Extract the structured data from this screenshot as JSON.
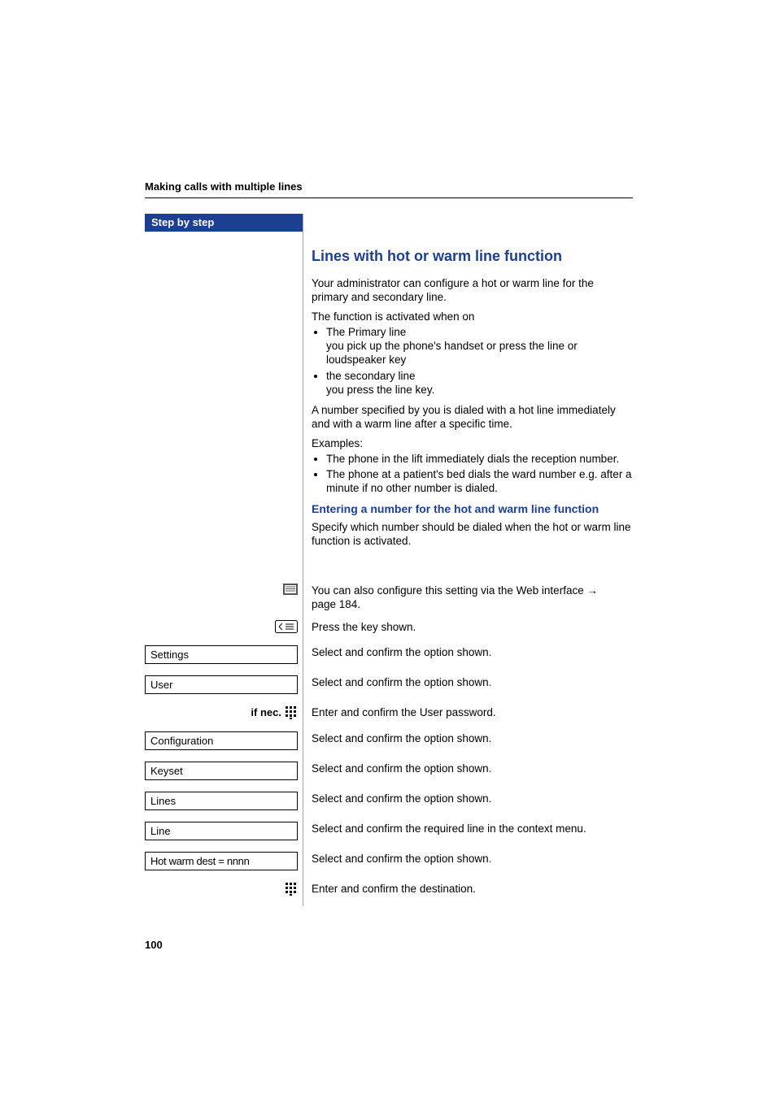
{
  "header": {
    "breadcrumb": "Making calls with multiple lines"
  },
  "sidebar": {
    "band_label": "Step by step"
  },
  "content": {
    "section_title": "Lines with hot or warm line function",
    "intro1": "Your administrator can configure a hot or warm line for the primary and secondary line.",
    "activated_lead": "The function is activated when on",
    "activated_list": {
      "item1_a": "The Primary line",
      "item1_b": "you pick up the phone's handset or press the line or loudspeaker key",
      "item2_a": "the secondary line",
      "item2_b": "you press the line key."
    },
    "dialed_text": "A number specified by you is dialed with a hot line immediately and with a warm line after a specific time.",
    "examples_lead": "Examples:",
    "examples_list": {
      "ex1": "The phone in the lift immediately dials the reception number.",
      "ex2": "The phone at a patient's bed dials the ward number e.g. after a minute if no other number is dialed."
    },
    "sub_heading": "Entering a number for the hot and warm line function",
    "specify_text": "Specify which number should be dialed when the hot or warm line function is activated.",
    "web_text_pre": "You can also configure this setting via the Web interface ",
    "web_text_arrow": "→",
    "web_text_post": " page 184.",
    "press_key_text": "Press the key shown."
  },
  "steps": {
    "settings": {
      "label": "Settings",
      "text": "Select and confirm the option shown."
    },
    "user": {
      "label": "User",
      "text": "Select and confirm the option shown."
    },
    "ifnec": {
      "prefix": "if nec.",
      "text": "Enter and confirm the User password."
    },
    "configuration": {
      "label": "Configuration",
      "text": "Select and confirm the option shown."
    },
    "keyset": {
      "label": "Keyset",
      "text": "Select and confirm the option shown."
    },
    "lines": {
      "label": "Lines",
      "text": "Select and confirm the option shown."
    },
    "line": {
      "label": "Line",
      "text": "Select and confirm the required line in the context menu."
    },
    "dest": {
      "label": "Hot warm dest = nnnn",
      "text": "Select and confirm the option shown."
    },
    "enter": {
      "text": "Enter and confirm the destination."
    }
  },
  "page_number": "100"
}
